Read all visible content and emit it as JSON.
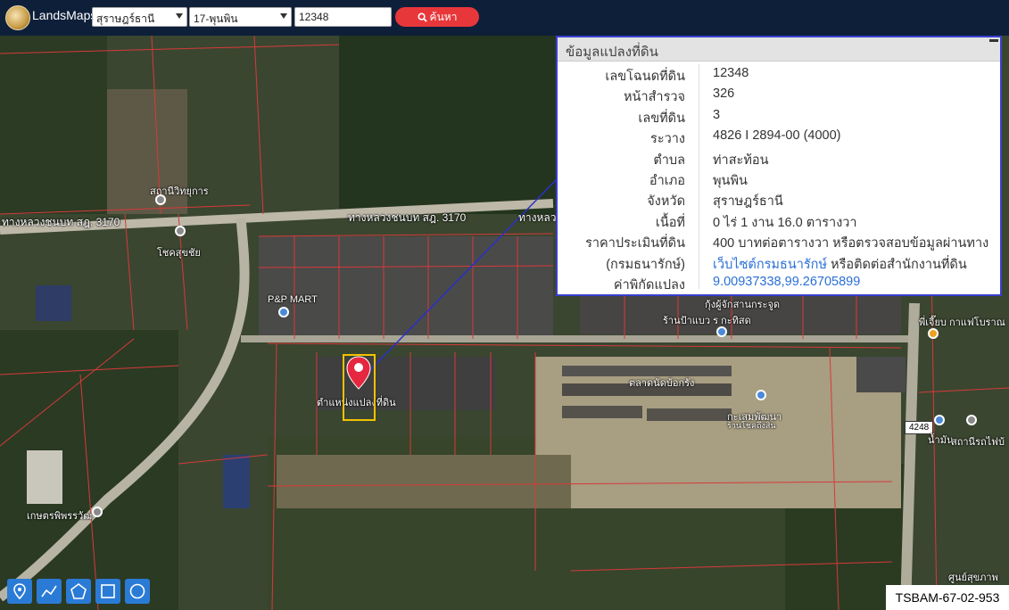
{
  "app": {
    "name": "LandsMaps"
  },
  "search": {
    "province": "สุราษฎร์ธานี",
    "district": "17-พุนพิน",
    "parcel_number": "12348",
    "button_label": "ค้นหา"
  },
  "info_panel": {
    "title": "ข้อมูลแปลงที่ดิน",
    "rows": [
      {
        "label": "เลขโฉนดที่ดิน",
        "value": "12348"
      },
      {
        "label": "หน้าสำรวจ",
        "value": "326"
      },
      {
        "label": "เลขที่ดิน",
        "value": "3"
      },
      {
        "label": "ระวาง",
        "value": "4826 I 2894-00 (4000)"
      },
      {
        "label": "ตำบล",
        "value": "ท่าสะท้อน"
      },
      {
        "label": "อำเภอ",
        "value": "พุนพิน"
      },
      {
        "label": "จังหวัด",
        "value": "สุราษฎร์ธานี"
      },
      {
        "label": "เนื้อที่",
        "value": "0 ไร่ 1 งาน 16.0 ตารางวา"
      },
      {
        "label": "ราคาประเมินที่ดิน",
        "value": "400 บาทต่อตารางวา หรือตรวจสอบข้อมูลผ่านทาง"
      },
      {
        "label": "(กรมธนารักษ์)",
        "value_link": "เว็บไซต์กรมธนารักษ์",
        "value_suffix": " หรือติดต่อสำนักงานที่ดิน"
      },
      {
        "label": "ค่าพิกัดแปลง",
        "value_link": "9.00937338,99.26705899"
      }
    ]
  },
  "map_labels": {
    "road_1": "ทางหลวงชนบท สฎ. 3170",
    "road_2": "ทางหลวงชนบท สฎ. 3170",
    "road_3": "ทางหลว",
    "poi_station": "สถานีวิทยุการ",
    "poi_shop1": "โชคสุขชัย",
    "poi_mart": "P&P MART",
    "poi_parcel": "ตำแหน่งแปลงที่ดิน",
    "poi_market": "ตลาดนัดบ้อกรัง",
    "poi_kasem": "กะเสมพัฒนา",
    "poi_kasem2": "ร้านโชคถึงสิน",
    "poi_kung": "กุ้งผู้จักสานกระจูด",
    "poi_shop2": "ร้านป้าแบว ร กะทิสด",
    "poi_cafe": "พี่เจี๊ยบ กาแฟโบราณ",
    "poi_water": "น้ำมัน",
    "poi_train": "สถานีรถไฟบ้",
    "poi_farm": "เกษตรพิพรรวัฒ",
    "poi_bottom": "ศูนย์สุขภาพ",
    "highway": "4248"
  },
  "tools": [
    "marker-tool",
    "polyline-tool",
    "polygon-tool",
    "rectangle-tool",
    "circle-tool"
  ],
  "watermark": "TSBAM-67-02-953",
  "colors": {
    "topbar": "#0e1f3a",
    "search_button": "#e8373a",
    "panel_border": "#3a3fcf",
    "parcel_box": "#f2c200",
    "parcel_lines": "#d63a3a",
    "tool_button": "#2a7bd6"
  }
}
